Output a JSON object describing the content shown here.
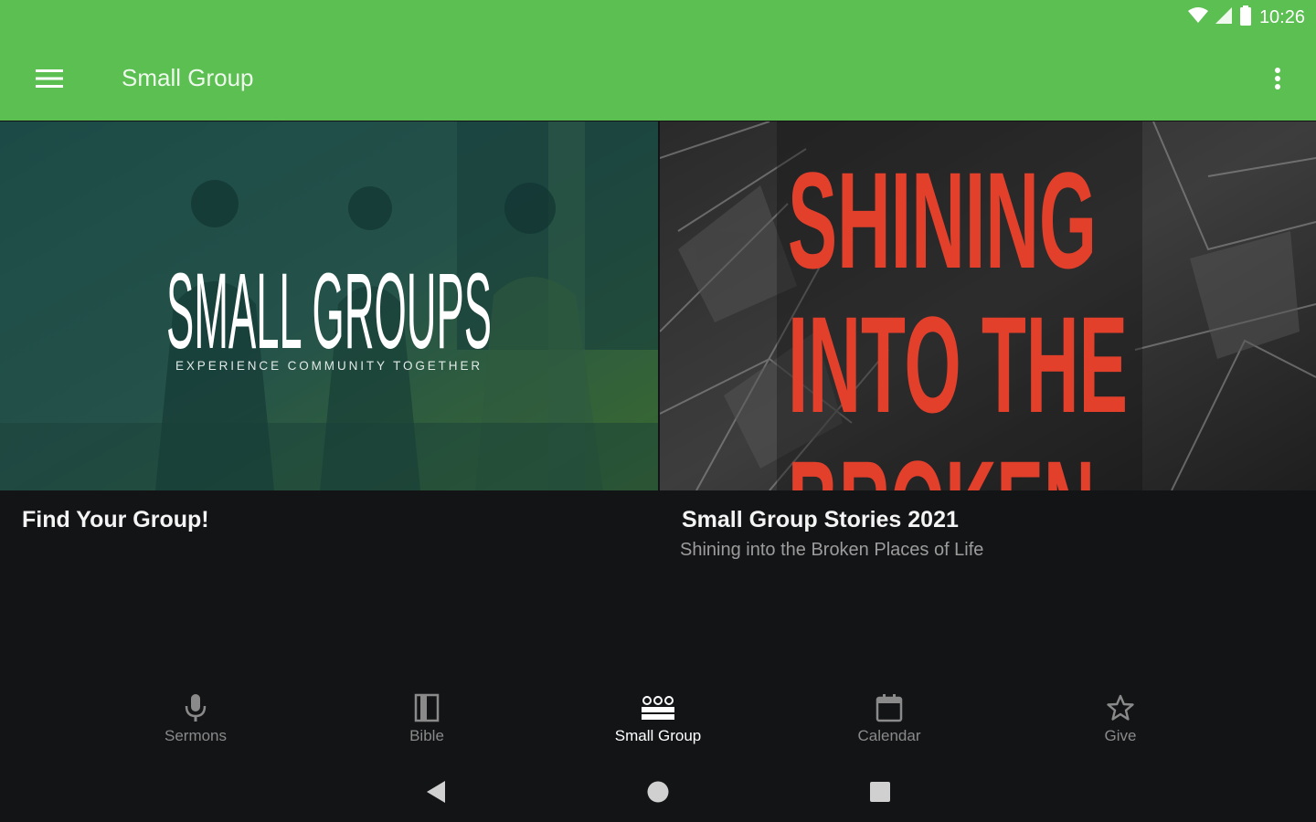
{
  "status_bar": {
    "time": "10:26"
  },
  "app_bar": {
    "title": "Small Group",
    "accent_color": "#5bbf52"
  },
  "cards": [
    {
      "banner_text": "SMALL GROUPS",
      "banner_tagline": "EXPERIENCE COMMUNITY TOGETHER",
      "title": "Find Your Group!",
      "subtitle": ""
    },
    {
      "banner_lines": [
        "SHINING",
        "INTO THE",
        "BROKEN"
      ],
      "title": "Small Group Stories 2021",
      "subtitle": "Shining into the Broken Places of Life"
    }
  ],
  "bottom_nav": [
    {
      "label": "Sermons",
      "icon": "microphone-icon",
      "active": false
    },
    {
      "label": "Bible",
      "icon": "book-icon",
      "active": false
    },
    {
      "label": "Small Group",
      "icon": "group-icon",
      "active": true
    },
    {
      "label": "Calendar",
      "icon": "calendar-icon",
      "active": false
    },
    {
      "label": "Give",
      "icon": "star-icon",
      "active": false
    }
  ],
  "system_nav": [
    "back-icon",
    "home-icon",
    "recents-icon"
  ]
}
